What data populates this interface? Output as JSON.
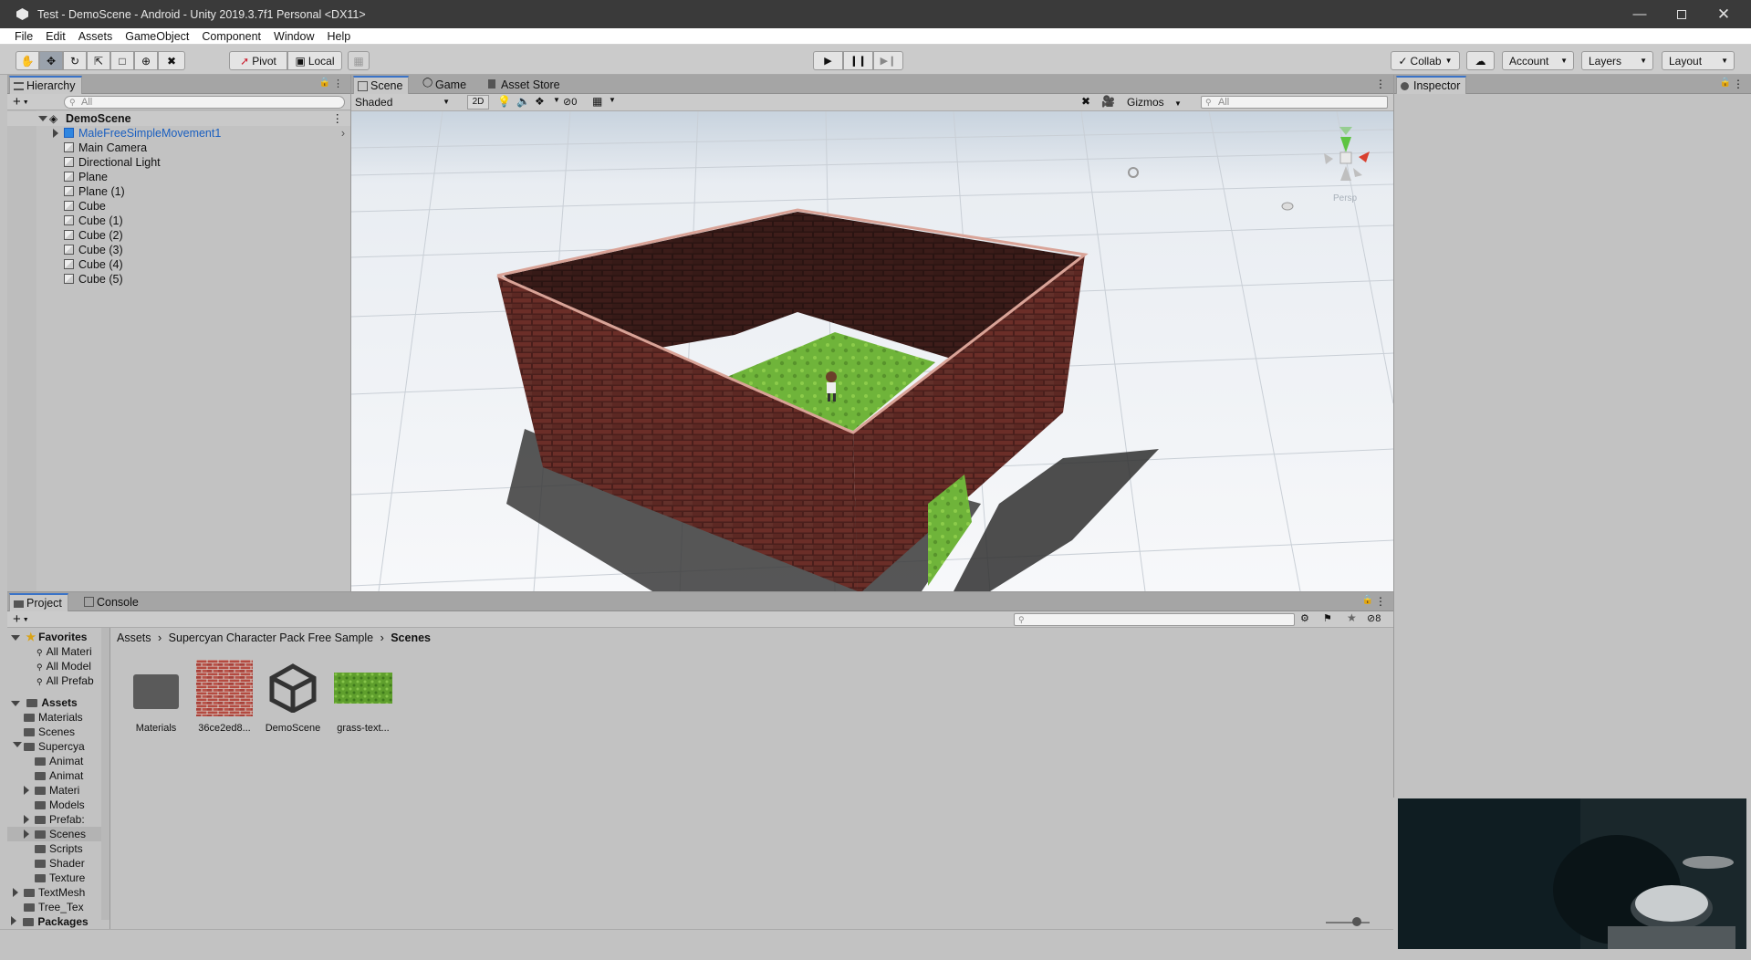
{
  "window": {
    "title": "Test - DemoScene - Android - Unity 2019.3.7f1 Personal <DX11>",
    "controls": [
      "minimize",
      "maximize",
      "close"
    ]
  },
  "menu": [
    "File",
    "Edit",
    "Assets",
    "GameObject",
    "Component",
    "Window",
    "Help"
  ],
  "toolbar": {
    "pivot_label": "Pivot",
    "local_label": "Local",
    "collab_label": "Collab",
    "account_label": "Account",
    "layers_label": "Layers",
    "layout_label": "Layout"
  },
  "hierarchy": {
    "tab_label": "Hierarchy",
    "search_placeholder": "All",
    "scene_name": "DemoScene",
    "items": [
      {
        "label": "MaleFreeSimpleMovement1",
        "type": "prefab",
        "selected_style": "blue"
      },
      {
        "label": "Main Camera"
      },
      {
        "label": "Directional Light"
      },
      {
        "label": "Plane"
      },
      {
        "label": "Plane (1)"
      },
      {
        "label": "Cube"
      },
      {
        "label": "Cube (1)"
      },
      {
        "label": "Cube (2)"
      },
      {
        "label": "Cube (3)"
      },
      {
        "label": "Cube (4)"
      },
      {
        "label": "Cube (5)"
      }
    ]
  },
  "scene_view": {
    "tabs": [
      "Scene",
      "Game",
      "Asset Store"
    ],
    "shading_mode": "Shaded",
    "mode_2d": "2D",
    "hidden_count": "0",
    "gizmos_label": "Gizmos",
    "search_placeholder": "All",
    "persp_label": "Persp"
  },
  "inspector": {
    "tab_label": "Inspector"
  },
  "project": {
    "tabs": [
      "Project",
      "Console"
    ],
    "hidden_count": "8",
    "breadcrumb": [
      "Assets",
      "Supercyan Character Pack Free Sample",
      "Scenes"
    ],
    "favorites_label": "Favorites",
    "favorites": [
      "All Materi",
      "All Model",
      "All Prefab"
    ],
    "assets_label": "Assets",
    "tree": [
      {
        "label": "Materials",
        "depth": 1
      },
      {
        "label": "Scenes",
        "depth": 1
      },
      {
        "label": "Supercya",
        "depth": 1,
        "expanded": true
      },
      {
        "label": "Animat",
        "depth": 2
      },
      {
        "label": "Animat",
        "depth": 2
      },
      {
        "label": "Materi",
        "depth": 2,
        "has_children": true
      },
      {
        "label": "Models",
        "depth": 2
      },
      {
        "label": "Prefab:",
        "depth": 2,
        "has_children": true
      },
      {
        "label": "Scenes",
        "depth": 2,
        "has_children": true,
        "selected": true
      },
      {
        "label": "Scripts",
        "depth": 2
      },
      {
        "label": "Shader",
        "depth": 2
      },
      {
        "label": "Texture",
        "depth": 2
      },
      {
        "label": "TextMesh",
        "depth": 1,
        "has_children": true
      },
      {
        "label": "Tree_Tex",
        "depth": 1
      }
    ],
    "packages_label": "Packages",
    "assets": [
      {
        "label": "Materials",
        "kind": "folder-icon"
      },
      {
        "label": "36ce2ed8...",
        "kind": "brick-texture"
      },
      {
        "label": "DemoScene",
        "kind": "unity-scene-icon"
      },
      {
        "label": "grass-text...",
        "kind": "grass-texture"
      }
    ]
  },
  "colors": {
    "title_bar": "#3a3a3a",
    "accent_blue": "#1a5fc0",
    "panel_bg": "#c2c2c2",
    "brick": "#5a2520",
    "grass": "#6fb43a"
  }
}
